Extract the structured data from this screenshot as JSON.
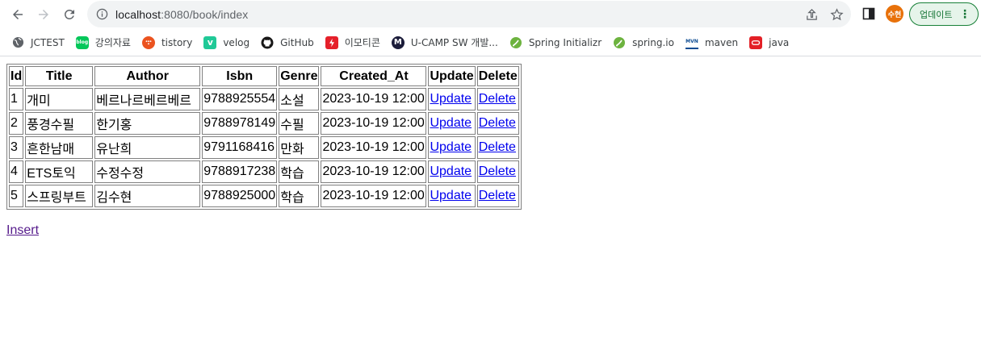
{
  "browser": {
    "url_host": "localhost",
    "url_rest": ":8080/book/index",
    "avatar_text": "수현",
    "update_label": "업데이트"
  },
  "bookmarks": [
    {
      "label": "JCTEST",
      "icon": "globe-icon",
      "color": "#5f6368"
    },
    {
      "label": "강의자료",
      "icon": "blog-icon",
      "color": "#03c75a"
    },
    {
      "label": "tistory",
      "icon": "tistory-icon",
      "color": "#eb531f"
    },
    {
      "label": "velog",
      "icon": "velog-icon",
      "color": "#20c997"
    },
    {
      "label": "GitHub",
      "icon": "github-icon",
      "color": "#181717"
    },
    {
      "label": "이모티콘",
      "icon": "bolt-icon",
      "color": "#e5202a"
    },
    {
      "label": "U-CAMP SW 개발...",
      "icon": "ucamp-icon",
      "color": "#1b1c3a"
    },
    {
      "label": "Spring Initializr",
      "icon": "spring-icon",
      "color": "#6db33f"
    },
    {
      "label": "spring.io",
      "icon": "spring-icon",
      "color": "#6db33f"
    },
    {
      "label": "maven",
      "icon": "maven-icon",
      "color": "#0d4c92"
    },
    {
      "label": "java",
      "icon": "oracle-icon",
      "color": "#e32026"
    }
  ],
  "table": {
    "headers": [
      "Id",
      "Title",
      "Author",
      "Isbn",
      "Genre",
      "Created_At",
      "Update",
      "Delete"
    ],
    "rows": [
      {
        "id": "1",
        "title": "개미",
        "author": "베르나르베르베르",
        "isbn": "9788925554",
        "genre": "소설",
        "created_at": "2023-10-19 12:00",
        "update": "Update",
        "delete": "Delete"
      },
      {
        "id": "2",
        "title": "풍경수필",
        "author": "한기홍",
        "isbn": "9788978149",
        "genre": "수필",
        "created_at": "2023-10-19 12:00",
        "update": "Update",
        "delete": "Delete"
      },
      {
        "id": "3",
        "title": "흔한남매",
        "author": "유난희",
        "isbn": "9791168416",
        "genre": "만화",
        "created_at": "2023-10-19 12:00",
        "update": "Update",
        "delete": "Delete"
      },
      {
        "id": "4",
        "title": "ETS토익",
        "author": "수정수정",
        "isbn": "9788917238",
        "genre": "학습",
        "created_at": "2023-10-19 12:00",
        "update": "Update",
        "delete": "Delete"
      },
      {
        "id": "5",
        "title": "스프링부트",
        "author": "김수현",
        "isbn": "9788925000",
        "genre": "학습",
        "created_at": "2023-10-19 12:00",
        "update": "Update",
        "delete": "Delete"
      }
    ]
  },
  "insert_label": "Insert"
}
